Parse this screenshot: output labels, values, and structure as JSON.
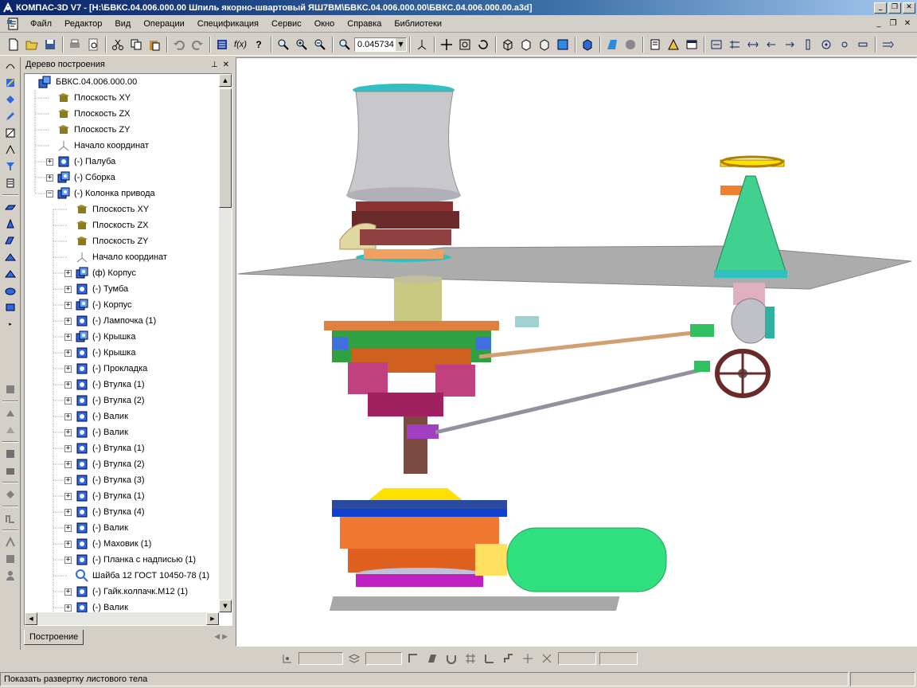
{
  "window": {
    "title": "КОМПАС-3D V7 - [H:\\БВКС.04.006.000.00 Шпиль якорно-швартовый ЯШ7ВМ\\БВКС.04.006.000.00\\БВКС.04.006.000.00.a3d]"
  },
  "menu": [
    "Файл",
    "Редактор",
    "Вид",
    "Операции",
    "Спецификация",
    "Сервис",
    "Окно",
    "Справка",
    "Библиотеки"
  ],
  "toolbar": {
    "zoom_value": "0.045734"
  },
  "tree": {
    "panel_title": "Дерево построения",
    "items": [
      {
        "label": "БВКС.04.006.000.00",
        "icon": "assembly-icon",
        "level": 0,
        "expander": ""
      },
      {
        "label": "Плоскость XY",
        "icon": "plane-icon",
        "level": 1,
        "expander": ""
      },
      {
        "label": "Плоскость ZX",
        "icon": "plane-icon",
        "level": 1,
        "expander": ""
      },
      {
        "label": "Плоскость ZY",
        "icon": "plane-icon",
        "level": 1,
        "expander": ""
      },
      {
        "label": "Начало координат",
        "icon": "origin-icon",
        "level": 1,
        "expander": ""
      },
      {
        "label": "(-) Палуба",
        "icon": "part-icon",
        "level": 1,
        "expander": "+"
      },
      {
        "label": "(-) Сборка",
        "icon": "subassembly-icon",
        "level": 1,
        "expander": "+"
      },
      {
        "label": "(-) Колонка привода",
        "icon": "subassembly-icon",
        "level": 1,
        "expander": "−"
      },
      {
        "label": "Плоскость XY",
        "icon": "plane-icon",
        "level": 2,
        "expander": ""
      },
      {
        "label": "Плоскость ZX",
        "icon": "plane-icon",
        "level": 2,
        "expander": ""
      },
      {
        "label": "Плоскость ZY",
        "icon": "plane-icon",
        "level": 2,
        "expander": ""
      },
      {
        "label": "Начало координат",
        "icon": "origin-icon",
        "level": 2,
        "expander": ""
      },
      {
        "label": "(ф) Корпус",
        "icon": "subassembly-icon",
        "level": 2,
        "expander": "+"
      },
      {
        "label": "(-) Тумба",
        "icon": "part-icon",
        "level": 2,
        "expander": "+"
      },
      {
        "label": "(-) Корпус",
        "icon": "subassembly-icon",
        "level": 2,
        "expander": "+"
      },
      {
        "label": "(-) Лампочка (1)",
        "icon": "part-icon",
        "level": 2,
        "expander": "+"
      },
      {
        "label": "(-) Крышка",
        "icon": "subassembly-icon",
        "level": 2,
        "expander": "+"
      },
      {
        "label": "(-) Крышка",
        "icon": "part-icon",
        "level": 2,
        "expander": "+"
      },
      {
        "label": "(-) Прокладка",
        "icon": "part-icon",
        "level": 2,
        "expander": "+"
      },
      {
        "label": "(-) Втулка (1)",
        "icon": "part-icon",
        "level": 2,
        "expander": "+"
      },
      {
        "label": "(-) Втулка (2)",
        "icon": "part-icon",
        "level": 2,
        "expander": "+"
      },
      {
        "label": "(-) Валик",
        "icon": "part-icon",
        "level": 2,
        "expander": "+"
      },
      {
        "label": "(-) Валик",
        "icon": "part-icon",
        "level": 2,
        "expander": "+"
      },
      {
        "label": "(-) Втулка (1)",
        "icon": "part-icon",
        "level": 2,
        "expander": "+"
      },
      {
        "label": "(-) Втулка (2)",
        "icon": "part-icon",
        "level": 2,
        "expander": "+"
      },
      {
        "label": "(-) Втулка (3)",
        "icon": "part-icon",
        "level": 2,
        "expander": "+"
      },
      {
        "label": "(-) Втулка (1)",
        "icon": "part-icon",
        "level": 2,
        "expander": "+"
      },
      {
        "label": "(-) Втулка (4)",
        "icon": "part-icon",
        "level": 2,
        "expander": "+"
      },
      {
        "label": "(-) Валик",
        "icon": "part-icon",
        "level": 2,
        "expander": "+"
      },
      {
        "label": "(-) Маховик (1)",
        "icon": "part-icon",
        "level": 2,
        "expander": "+"
      },
      {
        "label": "(-) Планка с надписью (1)",
        "icon": "part-icon",
        "level": 2,
        "expander": "+"
      },
      {
        "label": "Шайба 12 ГОСТ 10450-78 (1)",
        "icon": "standard-part-icon",
        "level": 2,
        "expander": ""
      },
      {
        "label": "(-) Гайк.колпачк.М12 (1)",
        "icon": "part-icon",
        "level": 2,
        "expander": "+"
      },
      {
        "label": "(-) Валик",
        "icon": "part-icon",
        "level": 2,
        "expander": "+"
      }
    ],
    "tab_label": "Построение"
  },
  "status": {
    "hint": "Показать развертку листового тела"
  }
}
